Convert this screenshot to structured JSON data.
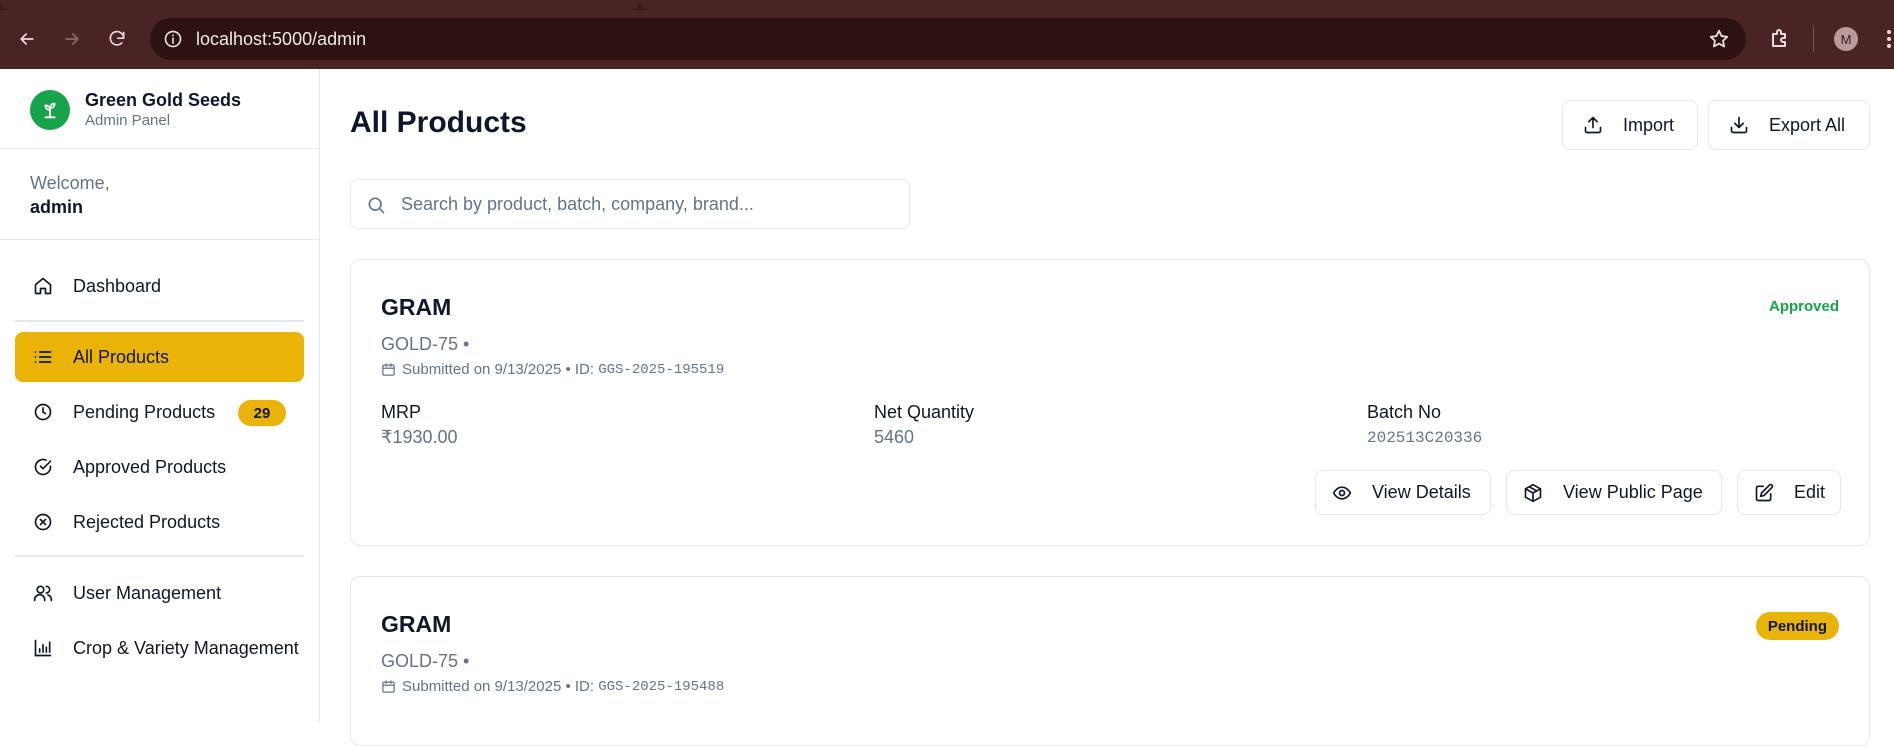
{
  "browser": {
    "url": "localhost:5000/admin",
    "profile_initial": "M"
  },
  "sidebar": {
    "brand_name": "Green Gold Seeds",
    "brand_subtitle": "Admin Panel",
    "welcome": "Welcome,",
    "username": "admin",
    "items": [
      {
        "label": "Dashboard",
        "icon": "home-icon"
      },
      {
        "label": "All Products",
        "icon": "list-icon",
        "active": true
      },
      {
        "label": "Pending Products",
        "icon": "clock-icon",
        "badge": "29"
      },
      {
        "label": "Approved Products",
        "icon": "check-circle-icon"
      },
      {
        "label": "Rejected Products",
        "icon": "x-circle-icon"
      },
      {
        "label": "User Management",
        "icon": "users-icon"
      },
      {
        "label": "Crop & Variety Management",
        "icon": "bar-chart-icon"
      }
    ]
  },
  "main": {
    "title": "All Products",
    "import_label": "Import",
    "export_label": "Export All",
    "search_placeholder": "Search by product, batch, company, brand..."
  },
  "products": [
    {
      "name": "GRAM",
      "variety": "GOLD-75 •",
      "submitted": "Submitted on 9/13/2025 • ID:",
      "id": "GGS-2025-195519",
      "status": "Approved",
      "mrp_label": "MRP",
      "mrp": "₹1930.00",
      "qty_label": "Net Quantity",
      "qty": "5460",
      "batch_label": "Batch No",
      "batch": "202513C20336",
      "actions": {
        "view": "View Details",
        "public": "View Public Page",
        "edit": "Edit"
      }
    },
    {
      "name": "GRAM",
      "variety": "GOLD-75 •",
      "submitted": "Submitted on 9/13/2025 • ID:",
      "id": "GGS-2025-195488",
      "status": "Pending"
    }
  ],
  "colors": {
    "accent": "#eab308",
    "brand_green": "#16a34a",
    "chrome": "#4a2425"
  }
}
